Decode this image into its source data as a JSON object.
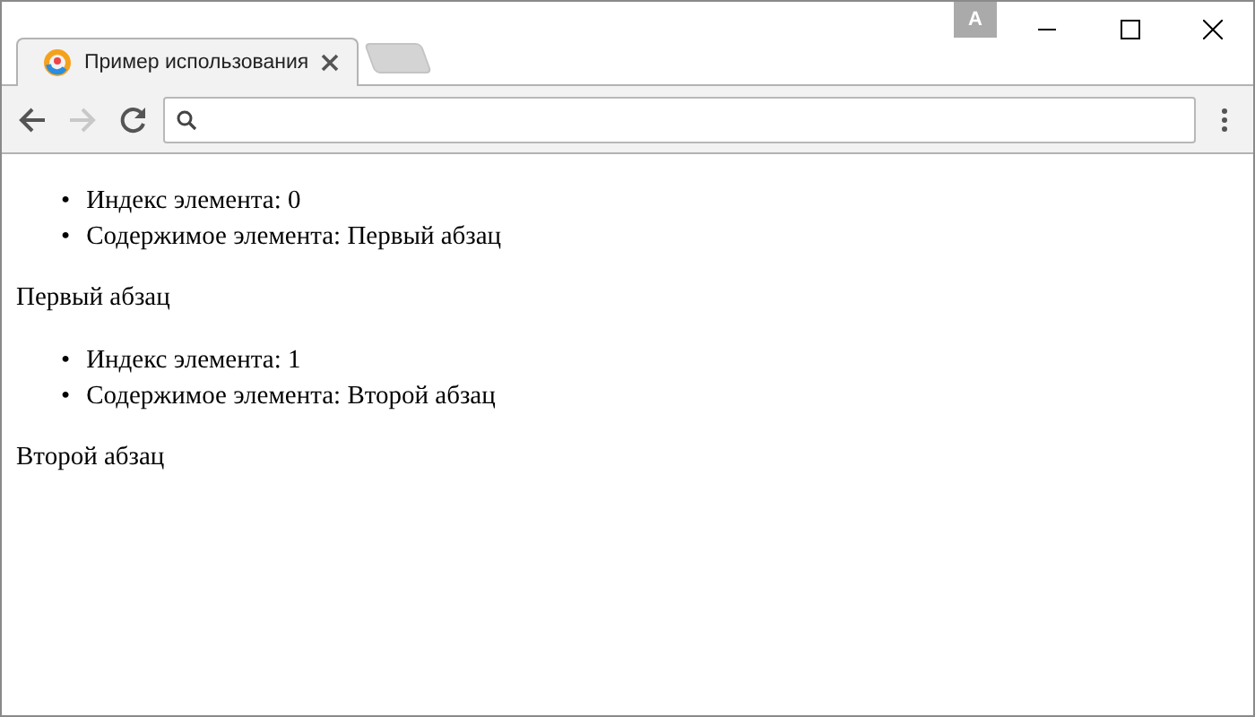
{
  "window": {
    "profile_badge": "A"
  },
  "tabs": [
    {
      "title": "Пример использования",
      "selected": true
    },
    {
      "selected": false
    }
  ],
  "toolbar": {
    "back_disabled": false,
    "forward_disabled": true
  },
  "content": [
    {
      "bullet": "•",
      "items": [
        "Индекс элемента: 0",
        "Содержимое элемента: Первый абзац"
      ],
      "paragraph": "Первый абзац"
    },
    {
      "bullet": "•",
      "items": [
        "Индекс элемента: 1",
        "Содержимое элемента: Второй абзац"
      ],
      "paragraph": "Второй абзац"
    }
  ]
}
